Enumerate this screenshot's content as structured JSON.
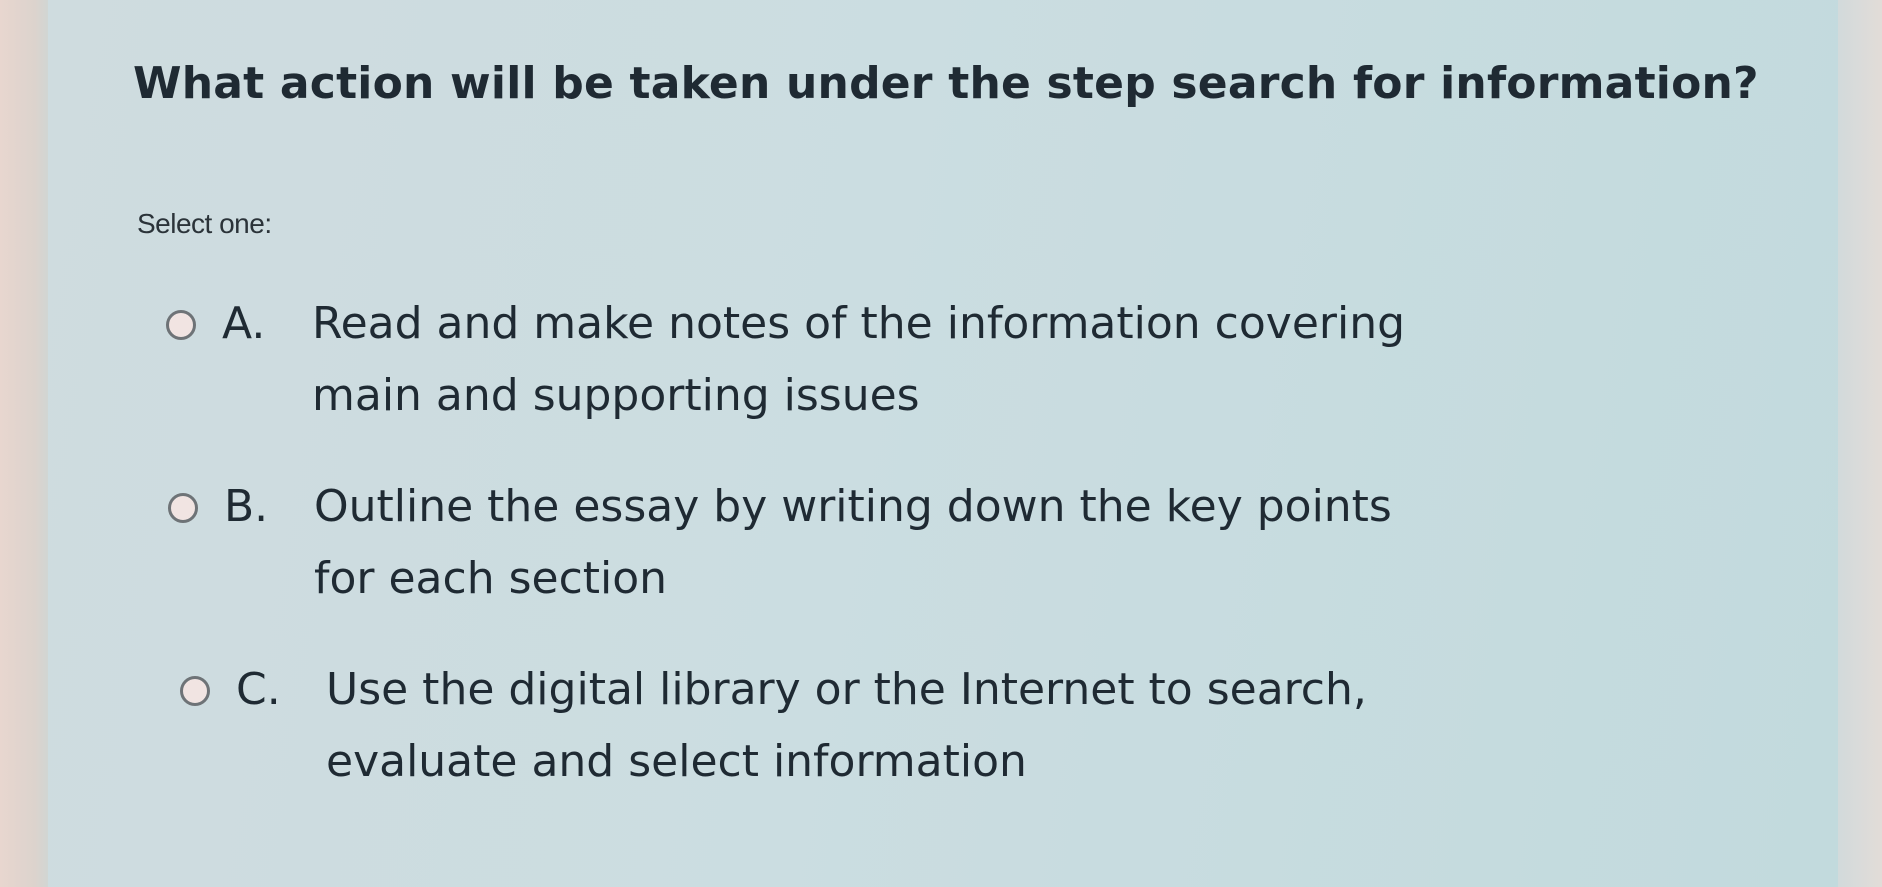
{
  "question": {
    "title": "What action will be taken under the step search for information?",
    "prompt": "Select one:"
  },
  "options": [
    {
      "letter": "A.",
      "text": "Read and make notes of the information covering main and supporting issues",
      "selected": false
    },
    {
      "letter": "B.",
      "text": "Outline the essay by writing down the key points for each section",
      "selected": false
    },
    {
      "letter": "C.",
      "text": "Use the digital library or the Internet to search, evaluate and select information",
      "selected": false
    }
  ],
  "colors": {
    "text": "#1f2a33",
    "background": "#cbdde1",
    "radio_border": "#6e7377"
  }
}
